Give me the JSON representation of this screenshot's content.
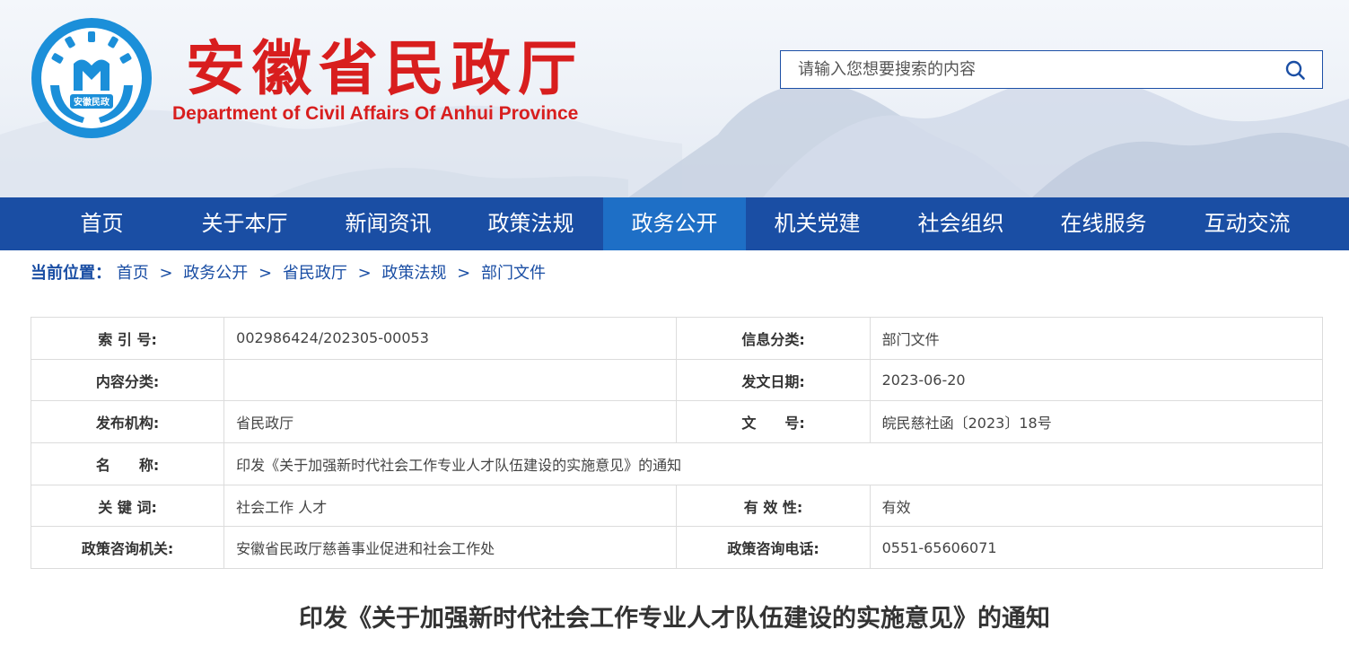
{
  "header": {
    "logo_text": "安徽民政",
    "title_cn": "安徽省民政厅",
    "title_en": "Department of Civil Affairs Of Anhui Province",
    "brand_color": "#d81e1e"
  },
  "search": {
    "placeholder": "请输入您想要搜索的内容",
    "icon": "search-icon"
  },
  "nav": {
    "items": [
      "首页",
      "关于本厅",
      "新闻资讯",
      "政策法规",
      "政务公开",
      "机关党建",
      "社会组织",
      "在线服务",
      "互动交流"
    ],
    "active": "政务公开",
    "color": "#1a4ea4",
    "active_color": "#1e6fc6"
  },
  "breadcrumb": {
    "label": "当前位置：",
    "items": [
      "首页",
      "政务公开",
      "省民政厅",
      "政策法规",
      "部门文件"
    ],
    "separator": ">"
  },
  "info": {
    "index_label": "索 引 号:",
    "index_value": "002986424/202305-00053",
    "category_label": "信息分类:",
    "category_value": "部门文件",
    "content_label": "内容分类:",
    "content_value": "",
    "date_label": "发文日期:",
    "date_value": "2023-06-20",
    "org_label": "发布机构:",
    "org_value": "省民政厅",
    "docno_label": "文　　号:",
    "docno_value": "皖民慈社函〔2023〕18号",
    "name_label": "名　　称:",
    "name_value": "印发《关于加强新时代社会工作专业人才队伍建设的实施意见》的通知",
    "keywords_label": "关 键 词:",
    "keywords_value": "社会工作 人才",
    "validity_label": "有 效 性:",
    "validity_value": "有效",
    "consult_org_label": "政策咨询机关:",
    "consult_org_value": "安徽省民政厅慈善事业促进和社会工作处",
    "consult_tel_label": "政策咨询电话:",
    "consult_tel_value": "0551-65606071"
  },
  "document": {
    "title": "印发《关于加强新时代社会工作专业人才队伍建设的实施意见》的通知"
  }
}
